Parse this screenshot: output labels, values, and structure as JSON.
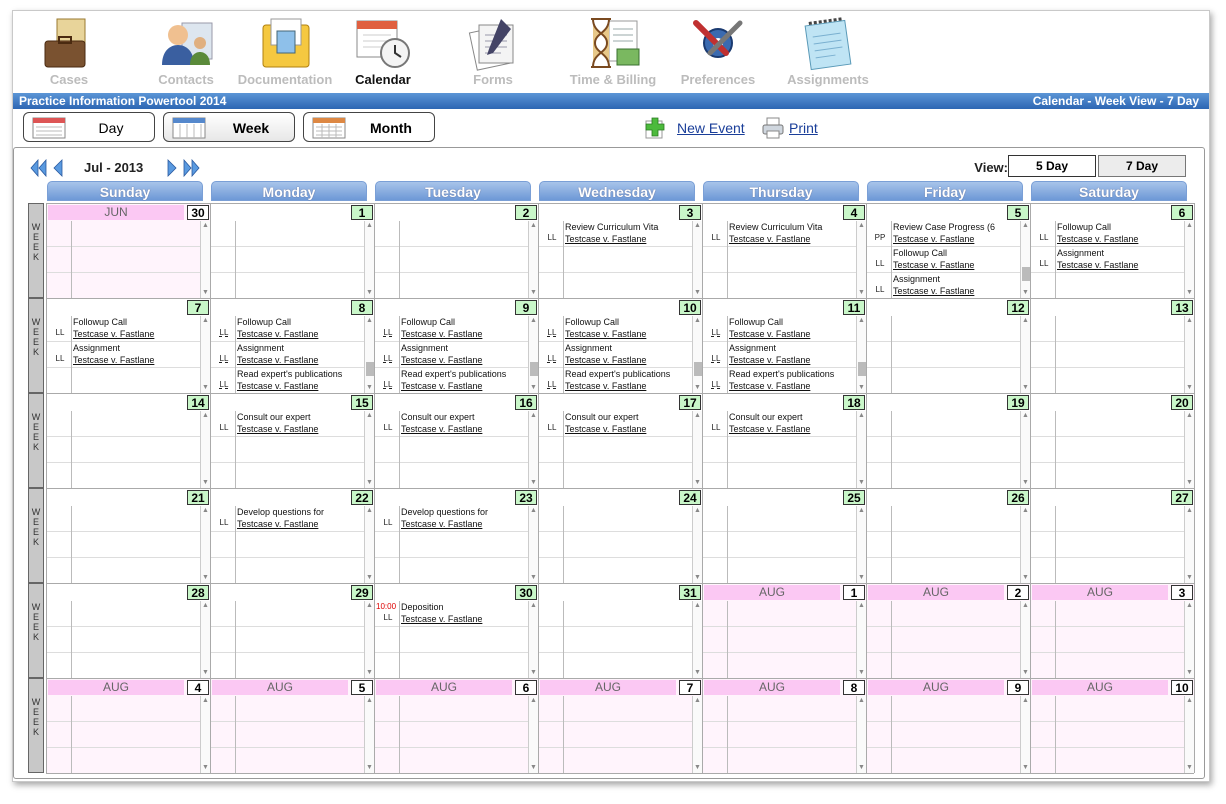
{
  "nav": [
    {
      "label": "Cases",
      "icon": "cases-icon",
      "active": false
    },
    {
      "label": "Contacts",
      "icon": "contacts-icon",
      "active": false
    },
    {
      "label": "Documentation",
      "icon": "documentation-icon",
      "active": false
    },
    {
      "label": "Calendar",
      "icon": "calendar-icon",
      "active": true
    },
    {
      "label": "Forms",
      "icon": "forms-icon",
      "active": false
    },
    {
      "label": "Time & Billing",
      "icon": "time-billing-icon",
      "active": false
    },
    {
      "label": "Preferences",
      "icon": "preferences-icon",
      "active": false
    },
    {
      "label": "Assignments",
      "icon": "assignments-icon",
      "active": false
    }
  ],
  "bar": {
    "app_title": "Practice Information Powertool 2014",
    "view_title": "Calendar - Week View - 7 Day"
  },
  "toolbar": {
    "day_label": "Day",
    "week_label": "Week",
    "month_label": "Month",
    "new_event_label": "New Event",
    "print_label": "Print"
  },
  "calendar": {
    "month_label": "Jul - 2013",
    "view_label": "View:",
    "five_day_label": "5 Day",
    "seven_day_label": "7 Day",
    "week_letters": [
      "W",
      "E",
      "E",
      "K"
    ],
    "days": [
      "Sunday",
      "Monday",
      "Tuesday",
      "Wednesday",
      "Thursday",
      "Friday",
      "Saturday"
    ],
    "weeks": [
      [
        {
          "num": "30",
          "month": "JUN",
          "out": true,
          "events": []
        },
        {
          "num": "1",
          "events": []
        },
        {
          "num": "2",
          "events": []
        },
        {
          "num": "3",
          "events": [
            {
              "title": "Review Curriculum Vita",
              "case": "Testcase v. Fastlane",
              "code": "LL"
            }
          ]
        },
        {
          "num": "4",
          "events": [
            {
              "title": "Review Curriculum Vita",
              "case": "Testcase v. Fastlane",
              "code": "LL"
            }
          ]
        },
        {
          "num": "5",
          "scroll": true,
          "events": [
            {
              "title": "Review Case Progress (6",
              "case": "Testcase v. Fastlane",
              "code": "PP"
            },
            {
              "title": "Followup Call",
              "case": "Testcase v. Fastlane",
              "code": "LL"
            },
            {
              "title": "Assignment",
              "case": "Testcase v. Fastlane",
              "code": "LL"
            }
          ]
        },
        {
          "num": "6",
          "events": [
            {
              "title": "Followup Call",
              "case": "Testcase v. Fastlane",
              "code": "LL"
            },
            {
              "title": "Assignment",
              "case": "Testcase v. Fastlane",
              "code": "LL"
            }
          ]
        }
      ],
      [
        {
          "num": "7",
          "events": [
            {
              "title": "Followup Call",
              "case": "Testcase v. Fastlane",
              "code": "LL"
            },
            {
              "title": "Assignment",
              "case": "Testcase v. Fastlane",
              "code": "LL"
            }
          ]
        },
        {
          "num": "8",
          "scroll": true,
          "events": [
            {
              "title": "Followup Call",
              "case": "Testcase v. Fastlane",
              "code": "LL"
            },
            {
              "title": "Assignment",
              "case": "Testcase v. Fastlane",
              "code": "LL"
            },
            {
              "title": "Read expert's publications",
              "case": "Testcase v. Fastlane",
              "code": "LL"
            }
          ]
        },
        {
          "num": "9",
          "scroll": true,
          "events": [
            {
              "title": "Followup Call",
              "case": "Testcase v. Fastlane",
              "code": "LL"
            },
            {
              "title": "Assignment",
              "case": "Testcase v. Fastlane",
              "code": "LL"
            },
            {
              "title": "Read expert's publications",
              "case": "Testcase v. Fastlane",
              "code": "LL"
            }
          ]
        },
        {
          "num": "10",
          "scroll": true,
          "events": [
            {
              "title": "Followup Call",
              "case": "Testcase v. Fastlane",
              "code": "LL"
            },
            {
              "title": "Assignment",
              "case": "Testcase v. Fastlane",
              "code": "LL"
            },
            {
              "title": "Read expert's publications",
              "case": "Testcase v. Fastlane",
              "code": "LL"
            }
          ]
        },
        {
          "num": "11",
          "scroll": true,
          "events": [
            {
              "title": "Followup Call",
              "case": "Testcase v. Fastlane",
              "code": "LL"
            },
            {
              "title": "Assignment",
              "case": "Testcase v. Fastlane",
              "code": "LL"
            },
            {
              "title": "Read expert's publications",
              "case": "Testcase v. Fastlane",
              "code": "LL"
            }
          ]
        },
        {
          "num": "12",
          "events": []
        },
        {
          "num": "13",
          "events": []
        }
      ],
      [
        {
          "num": "14",
          "events": []
        },
        {
          "num": "15",
          "events": [
            {
              "title": "Consult our expert",
              "case": "Testcase v. Fastlane",
              "code": "LL"
            }
          ]
        },
        {
          "num": "16",
          "events": [
            {
              "title": "Consult our expert",
              "case": "Testcase v. Fastlane",
              "code": "LL"
            }
          ]
        },
        {
          "num": "17",
          "events": [
            {
              "title": "Consult our expert",
              "case": "Testcase v. Fastlane",
              "code": "LL"
            }
          ]
        },
        {
          "num": "18",
          "events": [
            {
              "title": "Consult our expert",
              "case": "Testcase v. Fastlane",
              "code": "LL"
            }
          ]
        },
        {
          "num": "19",
          "events": []
        },
        {
          "num": "20",
          "events": []
        }
      ],
      [
        {
          "num": "21",
          "events": []
        },
        {
          "num": "22",
          "events": [
            {
              "title": "Develop questions for",
              "case": "Testcase v. Fastlane",
              "code": "LL"
            }
          ]
        },
        {
          "num": "23",
          "events": [
            {
              "title": "Develop questions for",
              "case": "Testcase v. Fastlane",
              "code": "LL"
            }
          ]
        },
        {
          "num": "24",
          "events": []
        },
        {
          "num": "25",
          "events": []
        },
        {
          "num": "26",
          "events": []
        },
        {
          "num": "27",
          "events": []
        }
      ],
      [
        {
          "num": "28",
          "events": []
        },
        {
          "num": "29",
          "events": []
        },
        {
          "num": "30",
          "events": [
            {
              "time": "10:00",
              "title": "Deposition",
              "case": "Testcase v. Fastlane",
              "code": "LL"
            }
          ]
        },
        {
          "num": "31",
          "events": []
        },
        {
          "num": "1",
          "month": "AUG",
          "out": true,
          "events": []
        },
        {
          "num": "2",
          "month": "AUG",
          "out": true,
          "events": []
        },
        {
          "num": "3",
          "month": "AUG",
          "out": true,
          "events": []
        }
      ],
      [
        {
          "num": "4",
          "month": "AUG",
          "out": true,
          "events": []
        },
        {
          "num": "5",
          "month": "AUG",
          "out": true,
          "events": []
        },
        {
          "num": "6",
          "month": "AUG",
          "out": true,
          "events": []
        },
        {
          "num": "7",
          "month": "AUG",
          "out": true,
          "events": []
        },
        {
          "num": "8",
          "month": "AUG",
          "out": true,
          "events": []
        },
        {
          "num": "9",
          "month": "AUG",
          "out": true,
          "events": []
        },
        {
          "num": "10",
          "month": "AUG",
          "out": true,
          "events": []
        }
      ]
    ]
  },
  "colors": {
    "accent_bar": "#2d66b3",
    "day_header": "#6d98d6",
    "day_number_bg": "#c9f7c9",
    "out_month_label": "#fbc8f3"
  }
}
